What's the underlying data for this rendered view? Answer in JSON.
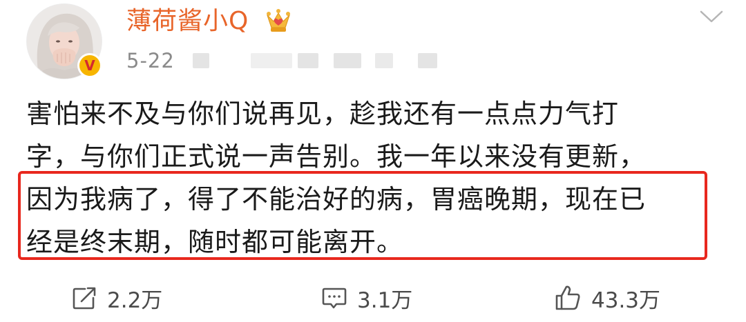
{
  "user": {
    "name": "薄荷酱小Q",
    "badge": "V",
    "post_time": "5-22"
  },
  "post": {
    "lines": [
      "害怕来不及与你们说再见，趁我还有一点点力气打",
      "字，与你们正式说一声告别。我一年以来没有更新，",
      "因为我病了，得了不能治好的病，胃癌晚期，现在已",
      "经是终末期，随时都可能离开。"
    ]
  },
  "actions": {
    "repost_count": "2.2万",
    "comment_count": "3.1万",
    "like_count": "43.3万"
  },
  "colors": {
    "username": "#e8652a",
    "highlight_border": "#e8281e",
    "meta_text": "#8a8a8a",
    "verified_badge": "#f7b500"
  },
  "icons": {
    "avatar": "avatar-photo",
    "verified": "verified-badge-icon",
    "crown": "crown-icon",
    "collapse": "chevron-down-icon",
    "repost": "repost-icon",
    "comment": "comment-icon",
    "like": "like-icon"
  }
}
